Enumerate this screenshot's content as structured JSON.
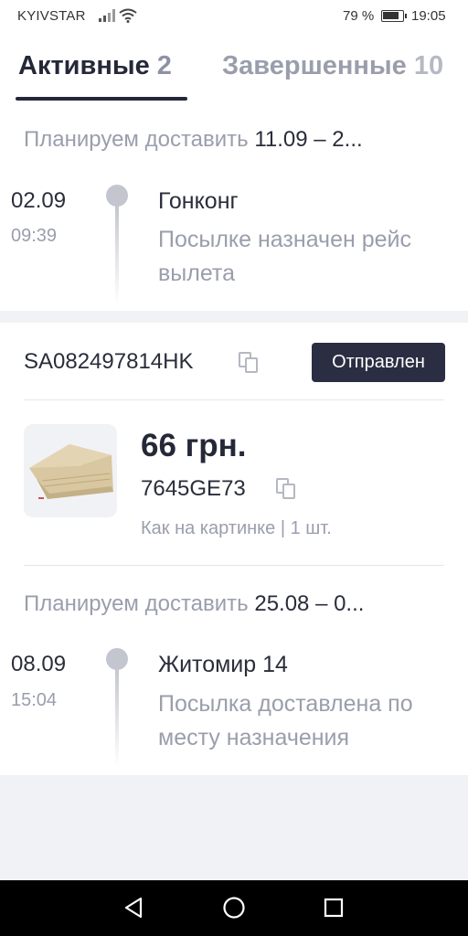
{
  "status_bar": {
    "carrier": "KYIVSTAR",
    "battery": "79 %",
    "time": "19:05"
  },
  "tabs": [
    {
      "label": "Активные",
      "count": "2"
    },
    {
      "label": "Завершенные",
      "count": "10"
    }
  ],
  "shipments": [
    {
      "plan_label": "Планируем доставить",
      "plan_dates": "11.09 – 2...",
      "event": {
        "date": "02.09",
        "time": "09:39",
        "place": "Гонконг",
        "description": "Посылке назначен рейс вылета"
      }
    },
    {
      "tracking_number": "SA082497814HK",
      "status": "Отправлен",
      "item": {
        "price": "66 грн.",
        "sku": "7645GE73",
        "variant": "Как на картинке | 1 шт."
      },
      "plan_label": "Планируем доставить",
      "plan_dates": "25.08 – 0...",
      "event": {
        "date": "08.09",
        "time": "15:04",
        "place": "Житомир 14",
        "description": "Посылка доставлена по месту назначения"
      }
    }
  ],
  "icons": [
    "signal-icon",
    "wifi-icon",
    "battery-icon",
    "copy-icon",
    "back-icon",
    "home-icon",
    "recents-icon"
  ],
  "colors": {
    "badge": "#2b2e42",
    "accent_text": "#252838",
    "muted_text": "#9a9eac"
  }
}
